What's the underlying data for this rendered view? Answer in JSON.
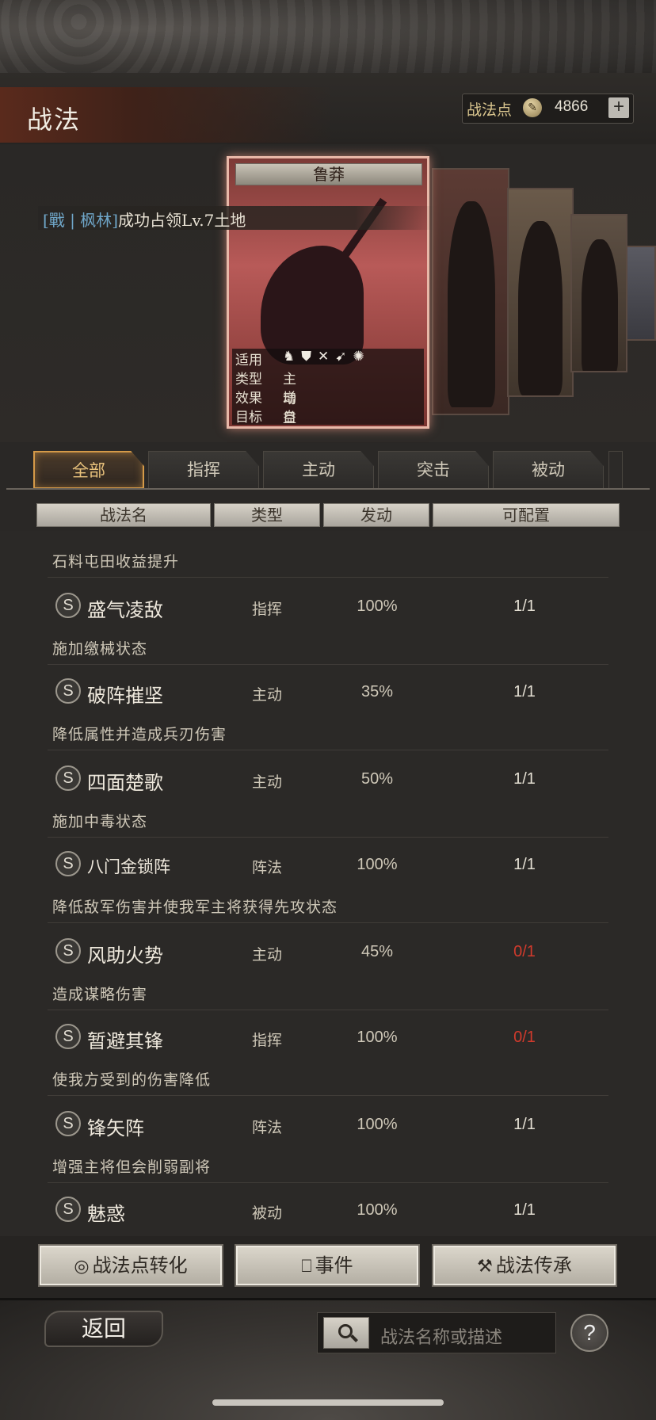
{
  "header": {
    "title": "战法",
    "points_label": "战法点",
    "points_value": "4866",
    "plus": "+"
  },
  "event": {
    "tag": "[戰 | 枫林]",
    "text": "成功占领Lv.7土地"
  },
  "card": {
    "name": "鲁莽",
    "rows": [
      {
        "key": "适用",
        "value": ""
      },
      {
        "key": "类型",
        "value": "主动"
      },
      {
        "key": "效果",
        "value": "增益"
      },
      {
        "key": "目标",
        "value": "自己"
      }
    ],
    "troop_icons": [
      "cavalry-icon",
      "shield-icon",
      "bow-icon",
      "spear-icon",
      "wheel-icon"
    ]
  },
  "tabs": [
    {
      "label": "全部",
      "active": true
    },
    {
      "label": "指挥",
      "active": false
    },
    {
      "label": "主动",
      "active": false
    },
    {
      "label": "突击",
      "active": false
    },
    {
      "label": "被动",
      "active": false
    }
  ],
  "columns": [
    "战法名",
    "类型",
    "发动",
    "可配置"
  ],
  "partial_desc": "石料屯田收益提升",
  "skills": [
    {
      "grade": "S",
      "name": "盛气凌敌",
      "type": "指挥",
      "rate": "100%",
      "config": "1/1",
      "config_color": "#e3ded2",
      "desc": "施加缴械状态"
    },
    {
      "grade": "S",
      "name": "破阵摧坚",
      "type": "主动",
      "rate": "35%",
      "config": "1/1",
      "config_color": "#e3ded2",
      "desc": "降低属性并造成兵刃伤害"
    },
    {
      "grade": "S",
      "name": "四面楚歌",
      "type": "主动",
      "rate": "50%",
      "config": "1/1",
      "config_color": "#e3ded2",
      "desc": "施加中毒状态"
    },
    {
      "grade": "S",
      "name": "八门金锁阵",
      "type": "阵法",
      "rate": "100%",
      "config": "1/1",
      "config_color": "#e3ded2",
      "desc": "降低敌军伤害并使我军主将获得先攻状态"
    },
    {
      "grade": "S",
      "name": "风助火势",
      "type": "主动",
      "rate": "45%",
      "config": "0/1",
      "config_color": "#d13a2c",
      "desc": "造成谋略伤害"
    },
    {
      "grade": "S",
      "name": "暂避其锋",
      "type": "指挥",
      "rate": "100%",
      "config": "0/1",
      "config_color": "#d13a2c",
      "desc": "使我方受到的伤害降低"
    },
    {
      "grade": "S",
      "name": "锋矢阵",
      "type": "阵法",
      "rate": "100%",
      "config": "1/1",
      "config_color": "#e3ded2",
      "desc": "增强主将但会削弱副将"
    },
    {
      "grade": "S",
      "name": "魅惑",
      "type": "被动",
      "rate": "100%",
      "config": "1/1",
      "config_color": "#e3ded2",
      "desc": ""
    }
  ],
  "actions": {
    "convert": "战法点转化",
    "event": "事件",
    "inherit": "战法传承"
  },
  "footer": {
    "back": "返回",
    "search_placeholder": "战法名称或描述",
    "help": "?"
  }
}
